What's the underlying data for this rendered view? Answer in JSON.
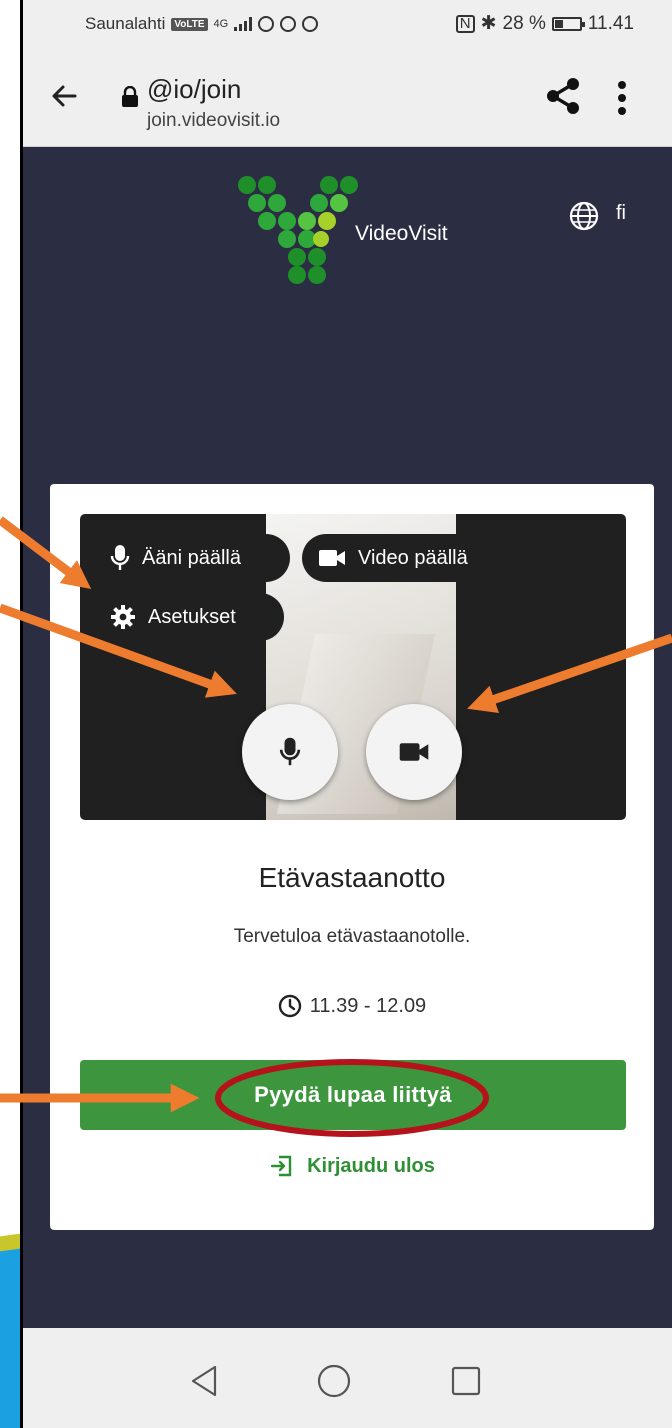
{
  "status_bar": {
    "carrier": "Saunalahti",
    "volte": "VoLTE",
    "network": "4G",
    "battery_percent": "28 %",
    "time": "11.41"
  },
  "browser": {
    "url_title": "@io/join",
    "url_host": "join.videovisit.io",
    "icons": [
      "back-arrow-icon",
      "lock-icon",
      "share-icon",
      "more-vertical-icon"
    ]
  },
  "header": {
    "brand": "VideoVisit",
    "language": "fi",
    "logo_colors": [
      "#1f8f2a",
      "#2ea83a",
      "#56c443",
      "#a6d12a"
    ]
  },
  "preview": {
    "audio_label": "Ääni päällä",
    "video_label": "Video päällä",
    "settings_label": "Asetukset"
  },
  "card": {
    "title": "Etävastaanotto",
    "welcome": "Tervetuloa etävastaanotolle.",
    "time_range": "11.39 - 12.09",
    "join_button": "Pyydä lupaa liittyä",
    "logout_link": "Kirjaudu ulos"
  },
  "colors": {
    "page_bg": "#2b2d43",
    "primary_green": "#3d963d",
    "annotation_arrow": "#ee7c2f",
    "annotation_circle": "#b5121b"
  }
}
